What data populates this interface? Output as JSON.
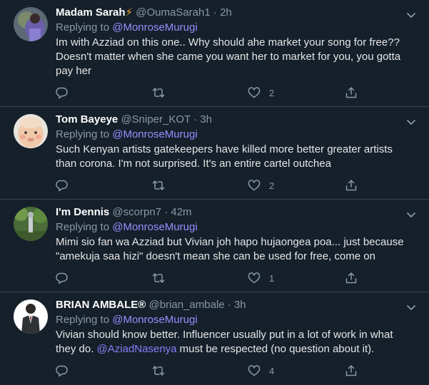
{
  "tweets": [
    {
      "name": "Madam Sarah",
      "badge": "⚡",
      "handle": "@OumaSarah1",
      "sep": "·",
      "time": "2h",
      "replying_prefix": "Replying to ",
      "replying_to": "@MonroseMurugi",
      "text": "Im with Azziad on this one.. Why should ahe market your song for free?? Doesn't matter when she came you want her to market for you, you gotta pay her",
      "likes": "2"
    },
    {
      "name": "Tom Bayeye",
      "handle": "@Sniper_KOT",
      "sep": "·",
      "time": "3h",
      "replying_prefix": "Replying to ",
      "replying_to": "@MonroseMurugi",
      "text": "Such Kenyan artists gatekeepers have killed more better greater artists than corona. I'm not surprised. It's an entire cartel outchea",
      "likes": "2"
    },
    {
      "name": "I'm Dennis",
      "handle": "@scorpn7",
      "sep": "·",
      "time": "42m",
      "replying_prefix": "Replying to ",
      "replying_to": "@MonroseMurugi",
      "text": "Mimi sio fan wa Azziad but Vivian joh hapo hujaongea poa... just because \"amekuja saa hizi\" doesn't mean she can be used for free, come on",
      "likes": "1"
    },
    {
      "name": "BRIAN AMBALE®",
      "handle": "@brian_ambale",
      "sep": "·",
      "time": "3h",
      "replying_prefix": "Replying to ",
      "replying_to": "@MonroseMurugi",
      "text_before": "Vivian should know better. Influencer usually put in a lot of work in what they do. ",
      "text_mention": "@AziadNasenya",
      "text_after": " must be respected (no question about it).",
      "likes": "4"
    }
  ],
  "icons": [
    "reply-icon",
    "retweet-icon",
    "like-icon",
    "share-icon",
    "chevron-down-icon"
  ],
  "colors": {
    "background": "#15202b",
    "divider": "#38444d",
    "muted": "#8899a6",
    "mention": "#9b8cff",
    "name": "#ffffff"
  }
}
